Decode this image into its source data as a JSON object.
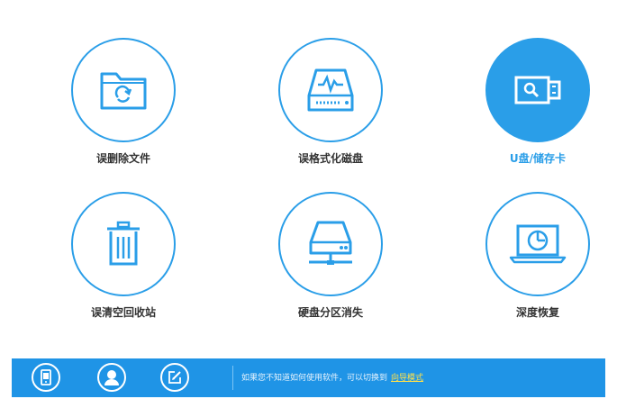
{
  "tiles": [
    {
      "label": "误删除文件",
      "icon": "recycle-folder-icon"
    },
    {
      "label": "误格式化磁盘",
      "icon": "disk-waveform-icon"
    },
    {
      "label": "U盘/储存卡",
      "icon": "usb-drive-icon"
    },
    {
      "label": "误清空回收站",
      "icon": "trash-bin-icon"
    },
    {
      "label": "硬盘分区消失",
      "icon": "network-drive-icon"
    },
    {
      "label": "深度恢复",
      "icon": "laptop-scan-icon"
    }
  ],
  "bottom_bar": {
    "buttons": [
      {
        "icon": "phone-icon"
      },
      {
        "icon": "user-icon"
      },
      {
        "icon": "edit-icon"
      }
    ],
    "hint_text": "如果您不知道如何使用软件，可以切换到",
    "link_text": "向导模式"
  },
  "colors": {
    "accent": "#2a9ee8",
    "bar": "#1f94e6",
    "link": "#ffe14a"
  }
}
